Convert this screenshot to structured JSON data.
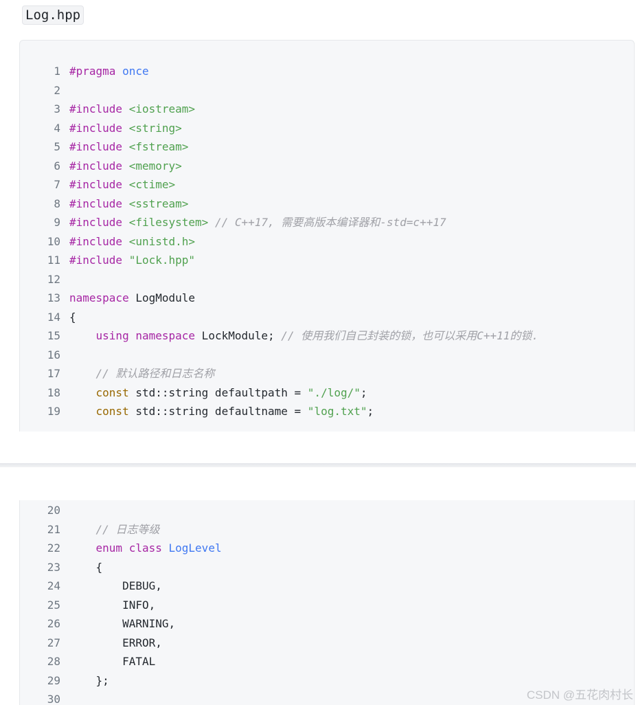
{
  "file_tab": {
    "label": "Log.hpp"
  },
  "code_panels": [
    {
      "lines": [
        {
          "no": "1",
          "indent": "",
          "tokens": [
            {
              "t": "#pragma",
              "c": "pp"
            },
            {
              "t": " ",
              "c": "pl"
            },
            {
              "t": "once",
              "c": "id"
            }
          ]
        },
        {
          "no": "2",
          "indent": "",
          "tokens": []
        },
        {
          "no": "3",
          "indent": "",
          "tokens": [
            {
              "t": "#include",
              "c": "pp"
            },
            {
              "t": " ",
              "c": "pl"
            },
            {
              "t": "<iostream>",
              "c": "str"
            }
          ]
        },
        {
          "no": "4",
          "indent": "",
          "tokens": [
            {
              "t": "#include",
              "c": "pp"
            },
            {
              "t": " ",
              "c": "pl"
            },
            {
              "t": "<string>",
              "c": "str"
            }
          ]
        },
        {
          "no": "5",
          "indent": "",
          "tokens": [
            {
              "t": "#include",
              "c": "pp"
            },
            {
              "t": " ",
              "c": "pl"
            },
            {
              "t": "<fstream>",
              "c": "str"
            }
          ]
        },
        {
          "no": "6",
          "indent": "",
          "tokens": [
            {
              "t": "#include",
              "c": "pp"
            },
            {
              "t": " ",
              "c": "pl"
            },
            {
              "t": "<memory>",
              "c": "str"
            }
          ]
        },
        {
          "no": "7",
          "indent": "",
          "tokens": [
            {
              "t": "#include",
              "c": "pp"
            },
            {
              "t": " ",
              "c": "pl"
            },
            {
              "t": "<ctime>",
              "c": "str"
            }
          ]
        },
        {
          "no": "8",
          "indent": "",
          "tokens": [
            {
              "t": "#include",
              "c": "pp"
            },
            {
              "t": " ",
              "c": "pl"
            },
            {
              "t": "<sstream>",
              "c": "str"
            }
          ]
        },
        {
          "no": "9",
          "indent": "",
          "tokens": [
            {
              "t": "#include",
              "c": "pp"
            },
            {
              "t": " ",
              "c": "pl"
            },
            {
              "t": "<filesystem>",
              "c": "str"
            },
            {
              "t": " ",
              "c": "pl"
            },
            {
              "t": "// C++17, 需要高版本编译器和-std=c++17",
              "c": "cm"
            }
          ]
        },
        {
          "no": "10",
          "indent": "",
          "tokens": [
            {
              "t": "#include",
              "c": "pp"
            },
            {
              "t": " ",
              "c": "pl"
            },
            {
              "t": "<unistd.h>",
              "c": "str"
            }
          ]
        },
        {
          "no": "11",
          "indent": "",
          "tokens": [
            {
              "t": "#include",
              "c": "pp"
            },
            {
              "t": " ",
              "c": "pl"
            },
            {
              "t": "\"Lock.hpp\"",
              "c": "str"
            }
          ]
        },
        {
          "no": "12",
          "indent": "",
          "tokens": []
        },
        {
          "no": "13",
          "indent": "",
          "tokens": [
            {
              "t": "namespace",
              "c": "kw"
            },
            {
              "t": " LogModule",
              "c": "pl"
            }
          ]
        },
        {
          "no": "14",
          "indent": "",
          "tokens": [
            {
              "t": "{",
              "c": "pl"
            }
          ]
        },
        {
          "no": "15",
          "indent": "    ",
          "tokens": [
            {
              "t": "using",
              "c": "kw"
            },
            {
              "t": " ",
              "c": "pl"
            },
            {
              "t": "namespace",
              "c": "kw"
            },
            {
              "t": " LockModule; ",
              "c": "pl"
            },
            {
              "t": "// 使用我们自己封装的锁，也可以采用C++11的锁.",
              "c": "cm"
            }
          ]
        },
        {
          "no": "16",
          "indent": "",
          "tokens": []
        },
        {
          "no": "17",
          "indent": "    ",
          "tokens": [
            {
              "t": "// 默认路径和日志名称",
              "c": "cm"
            }
          ]
        },
        {
          "no": "18",
          "indent": "    ",
          "tokens": [
            {
              "t": "const",
              "c": "kw2"
            },
            {
              "t": " std::string defaultpath = ",
              "c": "pl"
            },
            {
              "t": "\"./log/\"",
              "c": "str"
            },
            {
              "t": ";",
              "c": "pl"
            }
          ]
        },
        {
          "no": "19",
          "indent": "    ",
          "tokens": [
            {
              "t": "const",
              "c": "kw2"
            },
            {
              "t": " std::string defaultname = ",
              "c": "pl"
            },
            {
              "t": "\"log.txt\"",
              "c": "str"
            },
            {
              "t": ";",
              "c": "pl"
            }
          ]
        }
      ]
    },
    {
      "lines": [
        {
          "no": "20",
          "indent": "",
          "tokens": []
        },
        {
          "no": "21",
          "indent": "    ",
          "tokens": [
            {
              "t": "// 日志等级",
              "c": "cm"
            }
          ]
        },
        {
          "no": "22",
          "indent": "    ",
          "tokens": [
            {
              "t": "enum",
              "c": "kw"
            },
            {
              "t": " ",
              "c": "pl"
            },
            {
              "t": "class",
              "c": "kw"
            },
            {
              "t": " ",
              "c": "pl"
            },
            {
              "t": "LogLevel",
              "c": "id"
            }
          ]
        },
        {
          "no": "23",
          "indent": "    ",
          "tokens": [
            {
              "t": "{",
              "c": "pl"
            }
          ]
        },
        {
          "no": "24",
          "indent": "        ",
          "tokens": [
            {
              "t": "DEBUG,",
              "c": "pl"
            }
          ]
        },
        {
          "no": "25",
          "indent": "        ",
          "tokens": [
            {
              "t": "INFO,",
              "c": "pl"
            }
          ]
        },
        {
          "no": "26",
          "indent": "        ",
          "tokens": [
            {
              "t": "WARNING,",
              "c": "pl"
            }
          ]
        },
        {
          "no": "27",
          "indent": "        ",
          "tokens": [
            {
              "t": "ERROR,",
              "c": "pl"
            }
          ]
        },
        {
          "no": "28",
          "indent": "        ",
          "tokens": [
            {
              "t": "FATAL",
              "c": "pl"
            }
          ]
        },
        {
          "no": "29",
          "indent": "    ",
          "tokens": [
            {
              "t": "};",
              "c": "pl"
            }
          ]
        },
        {
          "no": "30",
          "indent": "",
          "tokens": []
        }
      ]
    }
  ],
  "watermark": {
    "text": "CSDN @五花肉村长"
  },
  "colors": {
    "preprocessor": "#a626a4",
    "keyword": "#a626a4",
    "type_keyword": "#986801",
    "string": "#50a14f",
    "identifier": "#4078f2",
    "comment": "#a0a1a7",
    "plain": "#24292f",
    "line_number": "#6e7781",
    "panel_background": "#f6f7f9"
  }
}
